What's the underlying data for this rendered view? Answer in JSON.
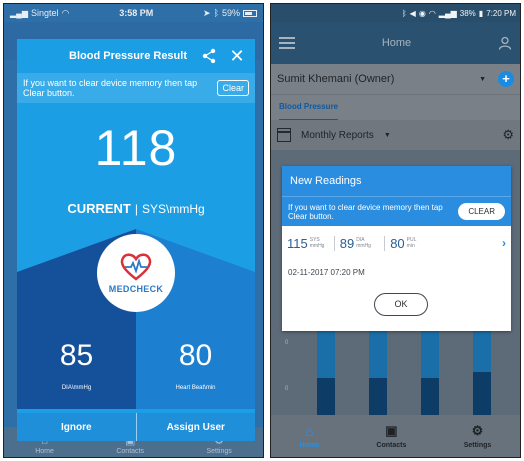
{
  "left_screen": {
    "status_bar": {
      "carrier": "Singtel",
      "time": "3:58 PM",
      "battery": "59%"
    },
    "bottom_nav": {
      "items": [
        "Home",
        "Contacts",
        "Settings"
      ]
    },
    "modal": {
      "title": "Blood Pressure Result",
      "notice_text": "If you want to clear device memory then tap Clear button.",
      "clear_label": "Clear",
      "systolic": "118",
      "current_label": "CURRENT",
      "unit_label": "SYS\\mmHg",
      "logo_text": "MEDCHECK",
      "diastolic": "85",
      "diastolic_label": "DIA\\mmHg",
      "heart_rate": "80",
      "heart_rate_label": "Heart Beat\\min",
      "ignore_label": "Ignore",
      "assign_label": "Assign User"
    }
  },
  "right_screen": {
    "status_bar": {
      "battery": "38%",
      "time": "7:20 PM"
    },
    "nav": {
      "title": "Home"
    },
    "user": {
      "name": "Sumit Khemani (Owner)"
    },
    "tab": {
      "label": "Blood Pressure"
    },
    "report": {
      "label": "Monthly Reports"
    },
    "chart_ticks": [
      "0",
      "0"
    ],
    "bottom_nav": {
      "home": "Home",
      "contacts": "Contacts",
      "settings": "Settings"
    },
    "card": {
      "title": "New Readings",
      "notice_text": "If you want to clear device memory then tap Clear button.",
      "clear_label": "CLEAR",
      "sys_value": "115",
      "sys_unit": "SYS mmHg",
      "dia_value": "89",
      "dia_unit": "DIA mmHg",
      "pul_value": "80",
      "pul_unit": "PUL min",
      "date": "02-11-2017 07:20 PM",
      "ok_label": "OK"
    }
  },
  "colors": {
    "accent_blue": "#1c9ee4",
    "dark_blue": "#15509a",
    "right_accent": "#2a8de0"
  }
}
